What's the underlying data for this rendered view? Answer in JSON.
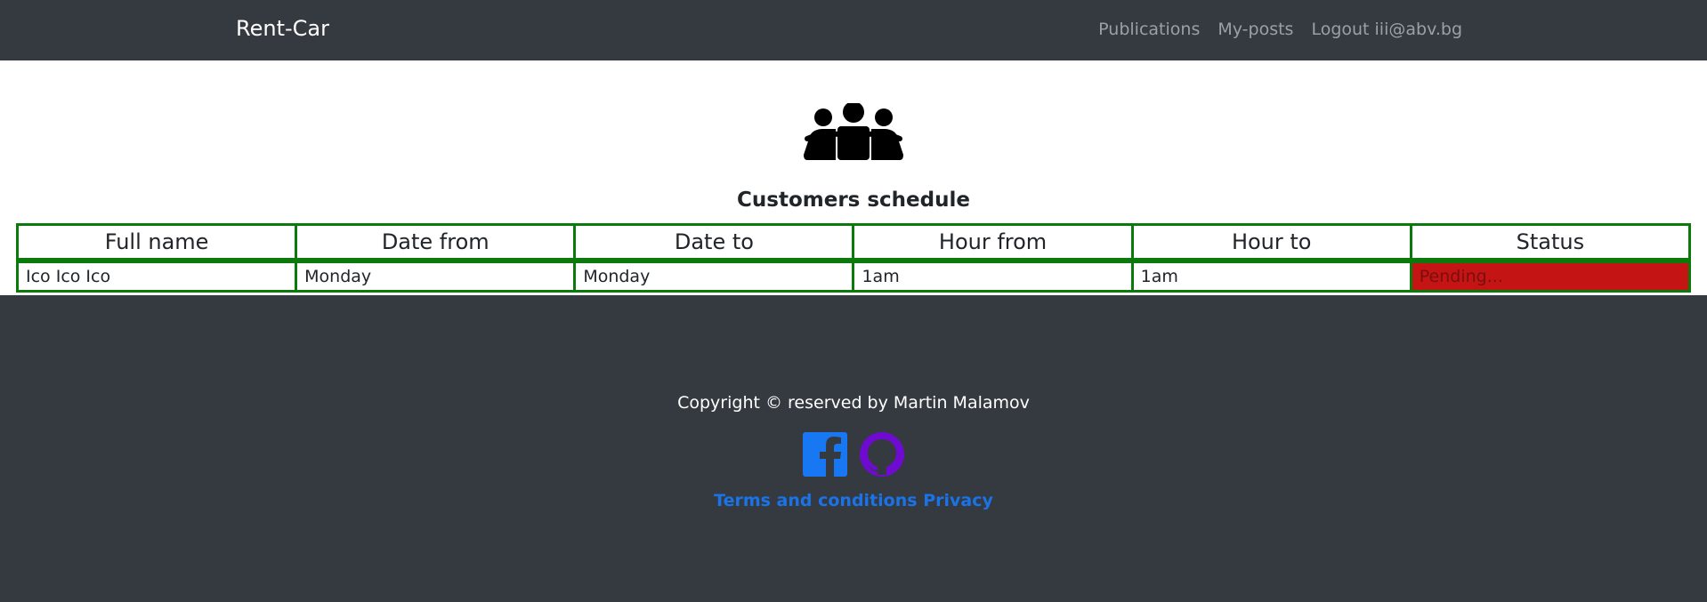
{
  "navbar": {
    "brand": "Rent-Car",
    "links": [
      {
        "label": "Publications"
      },
      {
        "label": "My-posts"
      },
      {
        "label": "Logout iii@abv.bg"
      }
    ]
  },
  "hero": {
    "icon": "users-group-icon",
    "title": "Customers schedule"
  },
  "table": {
    "headers": [
      "Full name",
      "Date from",
      "Date to",
      "Hour from",
      "Hour to",
      "Status"
    ],
    "rows": [
      {
        "full_name": "Ico Ico Ico",
        "date_from": "Monday",
        "date_to": "Monday",
        "hour_from": "1am",
        "hour_to": "1am",
        "status": "Pending..."
      }
    ]
  },
  "footer": {
    "copyright": "Copyright © reserved by Martin Malamov",
    "social_icons": [
      "facebook-icon",
      "github-icon"
    ],
    "terms_label": "Terms and conditions",
    "privacy_label": "Privacy"
  },
  "colors": {
    "nav_bg": "#343a40",
    "table_border": "#0b7a0b",
    "status_bg": "#c41414",
    "facebook": "#1877f2",
    "github": "#6f0bd1",
    "link": "#1a73e8"
  }
}
